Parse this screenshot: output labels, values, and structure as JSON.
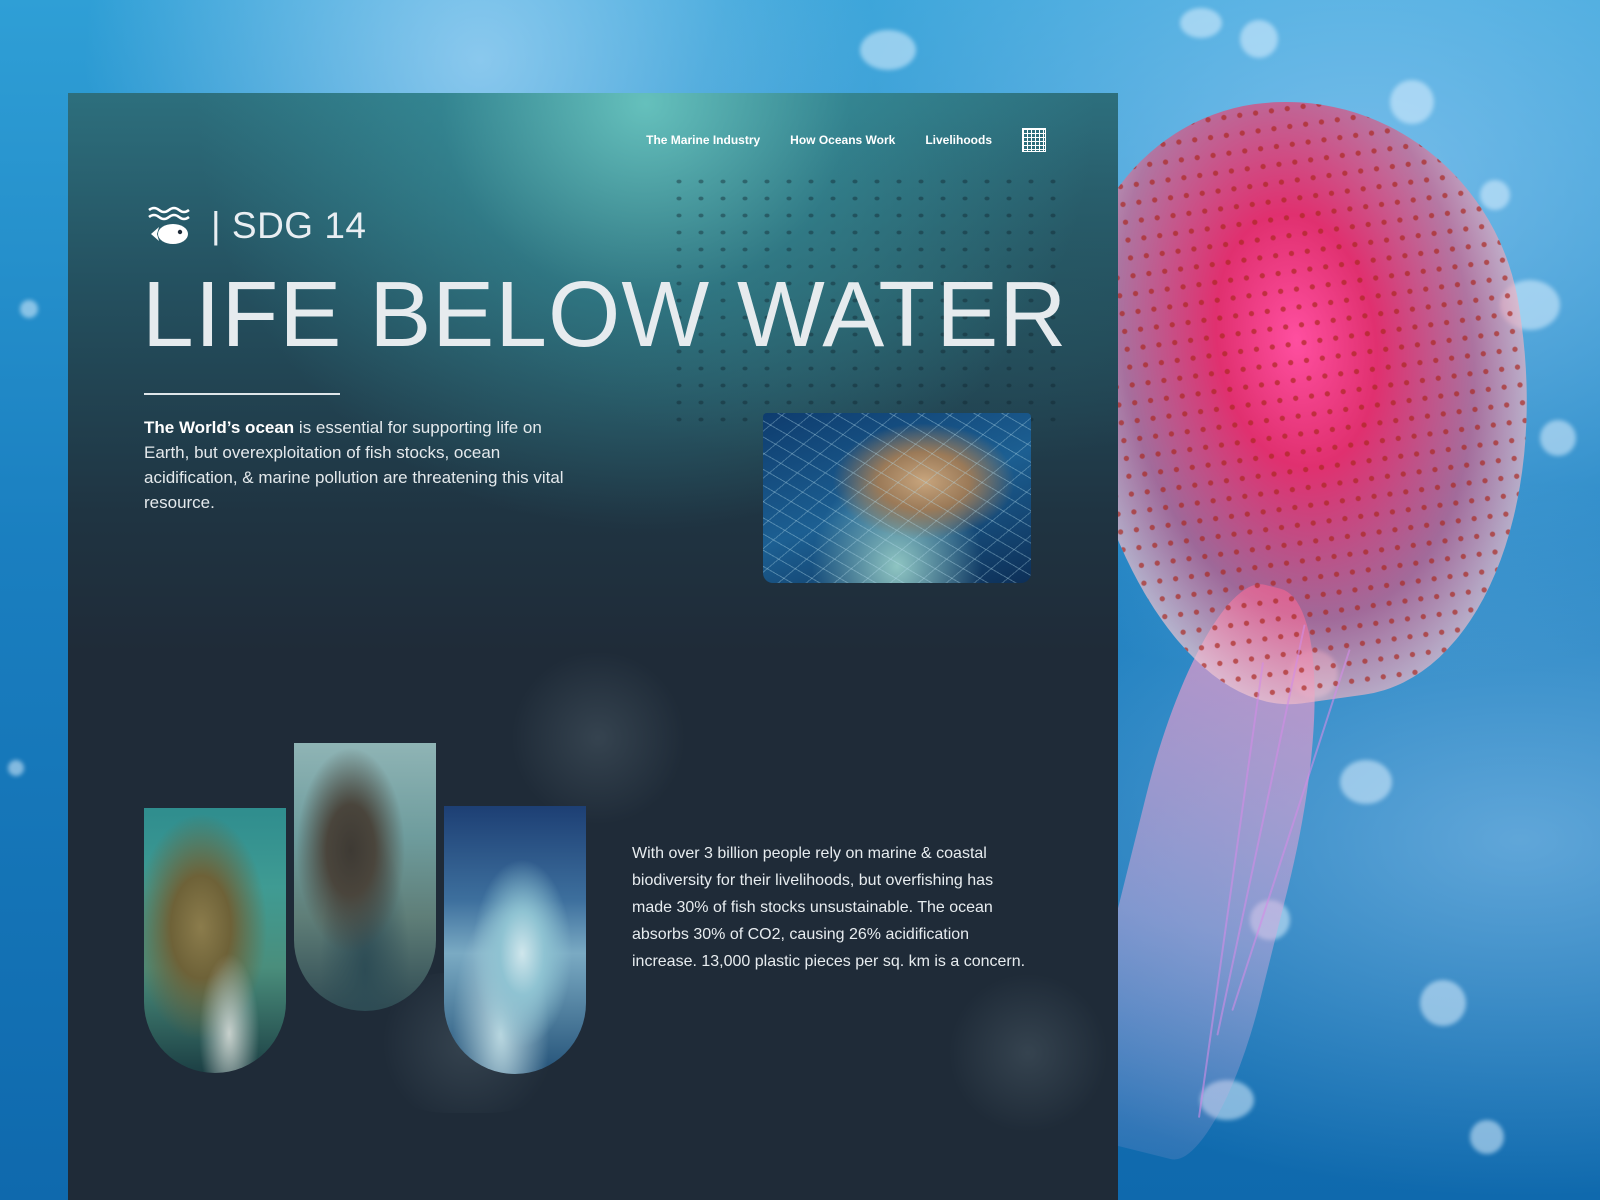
{
  "nav": {
    "items": [
      {
        "label": "The Marine Industry"
      },
      {
        "label": "How Oceans Work"
      },
      {
        "label": "Livelihoods"
      }
    ],
    "menu_icon": "grid-icon"
  },
  "hero": {
    "sdg_icon": "fish-waves-icon",
    "sdg_label": "| SDG 14",
    "title": "LIFE BELOW WATER",
    "intro_bold": "The World’s ocean",
    "intro_rest": " is essential for supporting life on Earth, but overexploitation of fish stocks, ocean acidification, & marine pollution are threatening this vital resource."
  },
  "stats": {
    "text": "With over 3 billion people rely on marine & coastal biodiversity for their livelihoods, but overfishing has made 30% of fish stocks unsustainable. The ocean absorbs 30% of CO2, causing 26% acidification increase. 13,000 plastic pieces per sq. km is a concern."
  },
  "colors": {
    "panel": "#1f2b38",
    "text": "#e6ebee",
    "ocean": "#1a7fc0"
  }
}
